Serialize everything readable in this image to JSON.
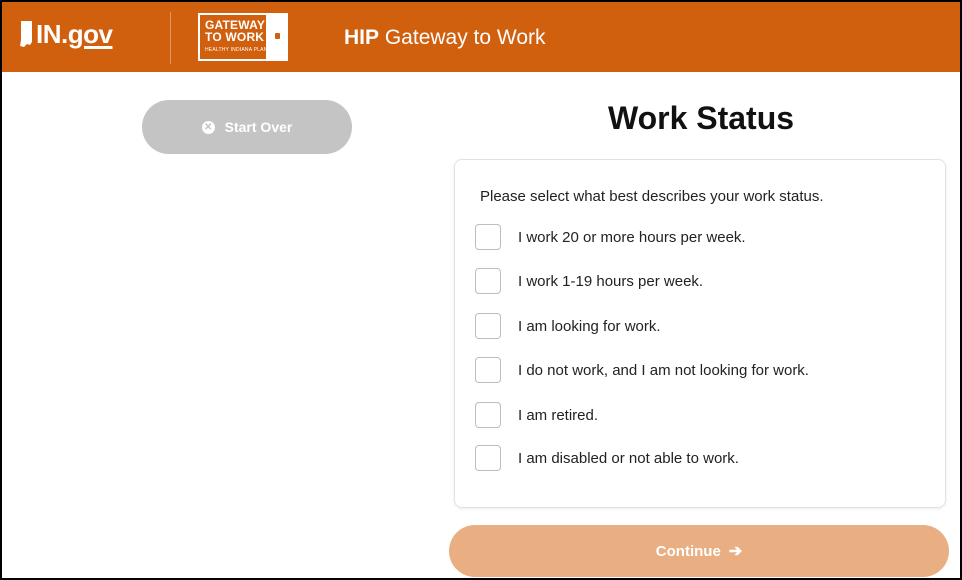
{
  "header": {
    "site_logo": "IN.gov",
    "site_logo_main": "IN.",
    "site_logo_suffix": "gov",
    "program_logo_line1": "GATEWAY",
    "program_logo_line2": "TO WORK",
    "program_logo_line3": "HEALTHY INDIANA PLAN",
    "app_title_bold": "HIP",
    "app_title_rest": " Gateway to Work",
    "brand_color": "#d05f0e"
  },
  "sidebar": {
    "start_over_label": "Start Over",
    "start_over_icon": "x-circle-icon"
  },
  "main": {
    "title": "Work Status",
    "prompt": "Please select what best describes your work status.",
    "options": [
      {
        "label": "I work 20 or more hours per week.",
        "checked": false
      },
      {
        "label": "I work 1-19 hours per week.",
        "checked": false
      },
      {
        "label": "I am looking for work.",
        "checked": false
      },
      {
        "label": "I do not work, and I am not looking for work.",
        "checked": false
      },
      {
        "label": "I am retired.",
        "checked": false
      },
      {
        "label": "I am disabled or not able to work.",
        "checked": false
      }
    ],
    "continue_label": "Continue",
    "continue_icon": "arrow-right-icon",
    "continue_color": "#e9ae82"
  }
}
